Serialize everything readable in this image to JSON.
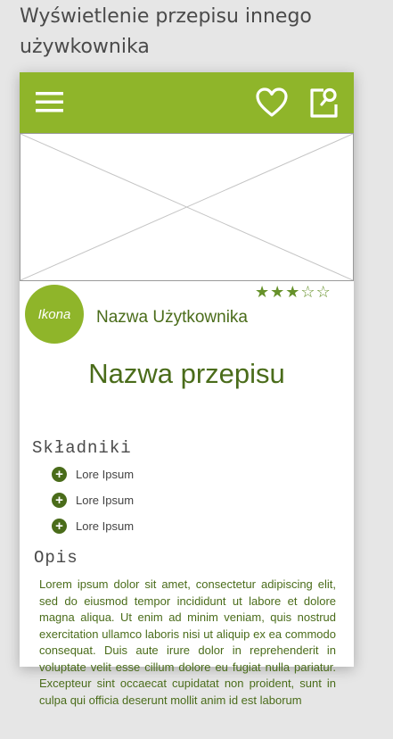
{
  "page": {
    "heading": "Wyświetlenie przepisu innego używkownika"
  },
  "appbar": {
    "menu_icon": "hamburger-menu-icon",
    "favorite_icon": "heart-icon",
    "search_icon": "search-document-icon",
    "accent_color": "#8fb52a"
  },
  "recipe": {
    "image_placeholder": "image-placeholder",
    "avatar_label": "Ikona",
    "username": "Nazwa Użytkownika",
    "rating": 3,
    "rating_max": 5,
    "title": "Nazwa przepisu",
    "ingredients_heading": "Składniki",
    "ingredients": [
      {
        "label": "Lore Ipsum"
      },
      {
        "label": "Lore Ipsum"
      },
      {
        "label": "Lore Ipsum"
      }
    ],
    "description_heading": "Opis",
    "description": "Lorem ipsum dolor sit amet, consectetur adipiscing elit, sed do eiusmod tempor incididunt ut labore et dolore magna aliqua. Ut enim ad minim veniam, quis nostrud exercitation ullamco laboris nisi ut aliquip ex ea commodo consequat. Duis aute irure dolor in reprehenderit in voluptate velit esse cillum dolore eu fugiat nulla pariatur. Excepteur sint occaecat cupidatat non proident, sunt in culpa qui officia deserunt mollit anim id est laborum",
    "primary_text_color": "#4a6c1a"
  }
}
